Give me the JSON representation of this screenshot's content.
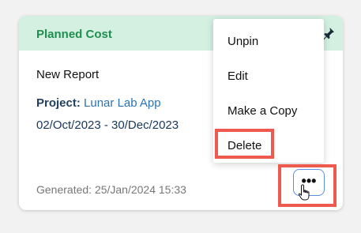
{
  "card": {
    "header_title": "Planned Cost",
    "report_title": "New Report",
    "project_label": "Project:",
    "project_value": "Lunar Lab App",
    "date_range": "02/Oct/2023 - 30/Dec/2023",
    "generated": "Generated: 25/Jan/2024 15:33"
  },
  "menu": {
    "items": [
      {
        "label": "Unpin"
      },
      {
        "label": "Edit"
      },
      {
        "label": "Make a Copy"
      },
      {
        "label": "Delete"
      }
    ]
  },
  "buttons": {
    "more_label": "•••"
  },
  "icons": {
    "pin": "pin-icon",
    "cursor": "hand-pointer-icon"
  },
  "colors": {
    "header_bg": "#d3f0e1",
    "header_text": "#1f8f4f",
    "highlight": "#ef5a4f",
    "link": "#2a73b4"
  }
}
